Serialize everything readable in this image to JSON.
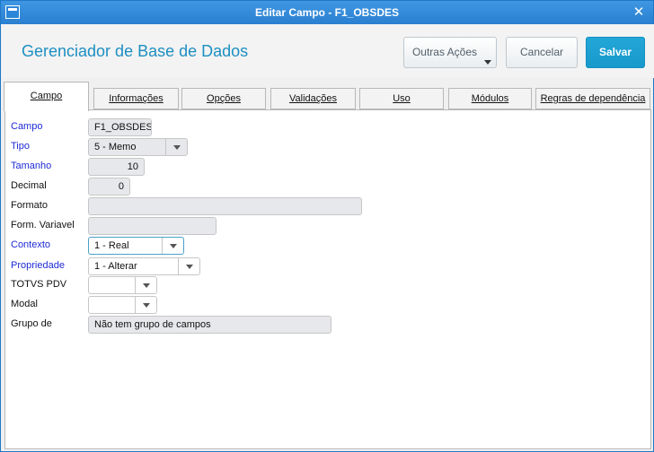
{
  "window": {
    "title": "Editar Campo - F1_OBSDES",
    "close_glyph": "✕"
  },
  "header": {
    "app_title": "Gerenciador de Base de Dados",
    "more_actions_label": "Outras Ações",
    "cancel_label": "Cancelar",
    "save_label": "Salvar",
    "accent_color": "#1d8fc2",
    "save_color": "#1899cb"
  },
  "tabs": [
    {
      "label": "Campo",
      "active": true
    },
    {
      "label": "Informações"
    },
    {
      "label": "Opções"
    },
    {
      "label": "Validações"
    },
    {
      "label": "Uso"
    },
    {
      "label": "Módulos"
    },
    {
      "label": "Regras de dependência"
    }
  ],
  "form": {
    "campo": {
      "label": "Campo",
      "value": "F1_OBSDES"
    },
    "tipo": {
      "label": "Tipo",
      "value": "5 - Memo"
    },
    "tamanho": {
      "label": "Tamanho",
      "value": "10"
    },
    "decimal": {
      "label": "Decimal",
      "value": "0"
    },
    "formato": {
      "label": "Formato",
      "value": ""
    },
    "form_variavel": {
      "label": "Form. Variavel",
      "value": ""
    },
    "contexto": {
      "label": "Contexto",
      "value": "1 - Real"
    },
    "propriedade": {
      "label": "Propriedade",
      "value": "1 - Alterar"
    },
    "totvs_pdv": {
      "label": "TOTVS PDV",
      "value": ""
    },
    "modal": {
      "label": "Modal",
      "value": ""
    },
    "grupo_de": {
      "label": "Grupo de",
      "value": "Não tem grupo de campos"
    }
  }
}
